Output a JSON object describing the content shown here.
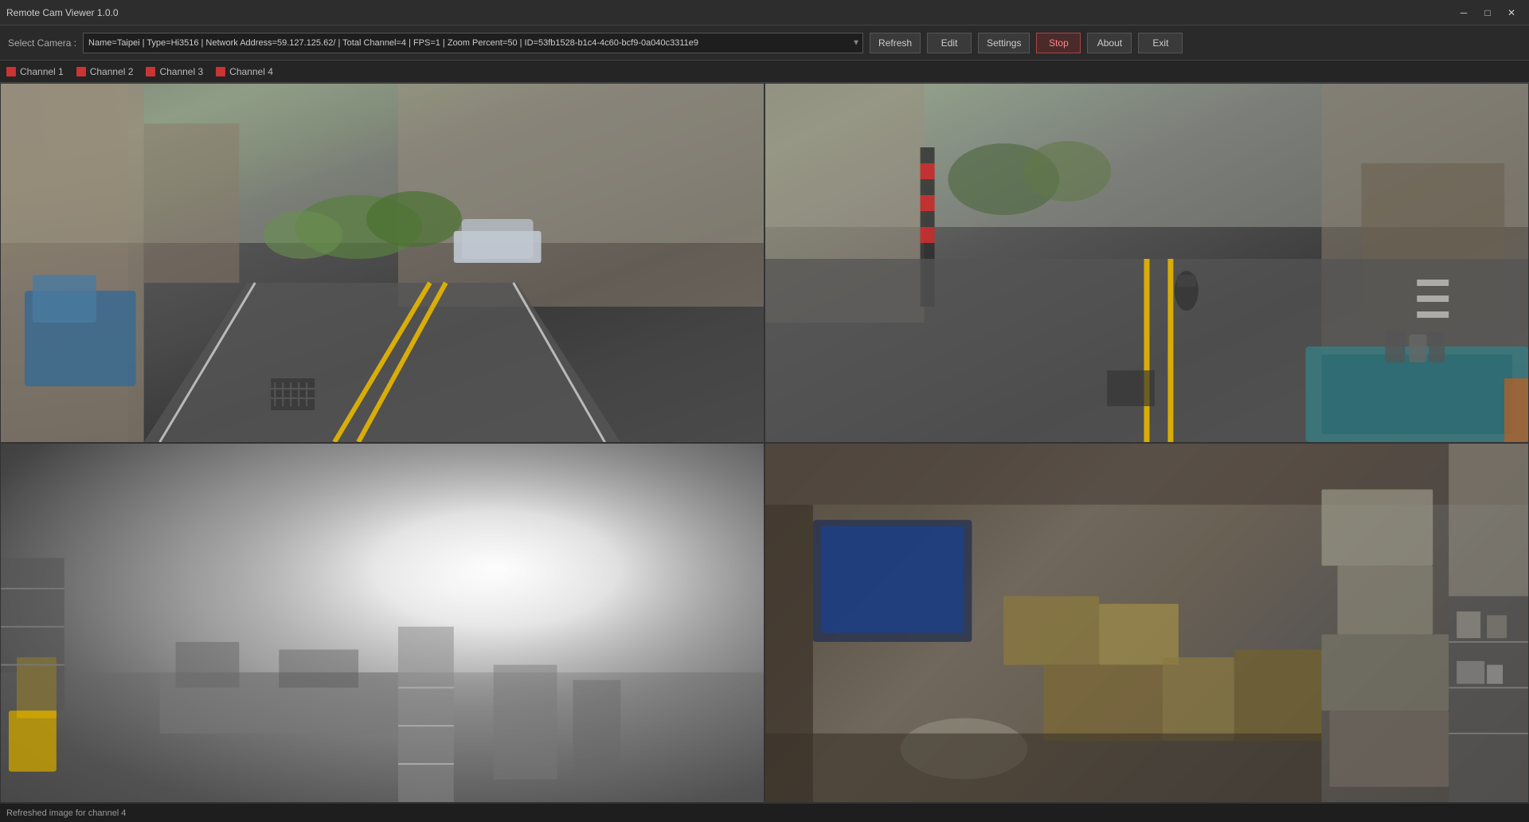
{
  "titlebar": {
    "title": "Remote Cam Viewer 1.0.0",
    "minimize_label": "─",
    "maximize_label": "□",
    "close_label": "✕"
  },
  "toolbar": {
    "camera_label": "Select Camera :",
    "camera_value": "Name=Taipei | Type=Hi3516 | Network Address=59.127.125.62/ | Total Channel=4 | FPS=1 | Zoom Percent=50 | ID=53fb1528-b1c4-4c60-bcf9-0a040c3311e9",
    "refresh_label": "Refresh",
    "edit_label": "Edit",
    "settings_label": "Settings",
    "stop_label": "Stop",
    "about_label": "About",
    "exit_label": "Exit"
  },
  "channels": [
    {
      "label": "Channel 1",
      "id": "ch1"
    },
    {
      "label": "Channel 2",
      "id": "ch2"
    },
    {
      "label": "Channel 3",
      "id": "ch3"
    },
    {
      "label": "Channel 4",
      "id": "ch4"
    }
  ],
  "statusbar": {
    "message": "Refreshed image for channel 4"
  }
}
